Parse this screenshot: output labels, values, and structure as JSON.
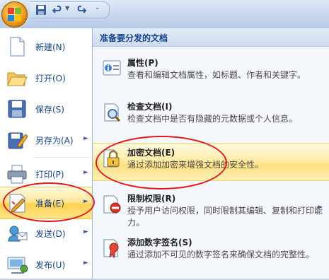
{
  "quick_access": {
    "office_button": "office-button",
    "buttons": [
      "save-icon",
      "undo-icon",
      "redo-icon"
    ]
  },
  "left_menu": {
    "items": [
      {
        "label": "新建(N)",
        "icon": "new-document-icon",
        "has_submenu": false
      },
      {
        "label": "打开(O)",
        "icon": "open-folder-icon",
        "has_submenu": false
      },
      {
        "label": "保存(S)",
        "icon": "save-disk-icon",
        "has_submenu": false
      },
      {
        "label": "另存为(A)",
        "icon": "save-as-icon",
        "has_submenu": true
      },
      {
        "label": "打印(P)",
        "icon": "printer-icon",
        "has_submenu": true
      },
      {
        "label": "准备(E)",
        "icon": "prepare-icon",
        "has_submenu": true,
        "active": true
      },
      {
        "label": "发送(D)",
        "icon": "send-icon",
        "has_submenu": true
      },
      {
        "label": "发布(U)",
        "icon": "publish-icon",
        "has_submenu": true
      }
    ]
  },
  "submenu": {
    "header": "准备要分发的文档",
    "items": [
      {
        "title": "属性(P)",
        "desc": "查看和编辑文档属性，如标题、作者和关键字。",
        "icon": "properties-icon"
      },
      {
        "title": "检查文档(I)",
        "desc": "检查文档中是否有隐藏的元数据或个人信息。",
        "icon": "inspect-document-icon"
      },
      {
        "title": "加密文档(E)",
        "desc": "通过添加加密来增强文档的安全性。",
        "icon": "encrypt-lock-icon",
        "highlighted": true
      },
      {
        "title": "限制权限(R)",
        "desc": "授予用户访问权限，同时限制其编辑、复制和打印能力。",
        "icon": "restrict-permission-icon",
        "has_submenu": true
      },
      {
        "title": "添加数字签名(S)",
        "desc": "通过添加不可见的数字签名来确保文档的完整性。",
        "icon": "digital-signature-icon"
      }
    ]
  },
  "colors": {
    "accent": "#15428b",
    "highlight": "#ffe185",
    "annotation": "#e0171b"
  }
}
